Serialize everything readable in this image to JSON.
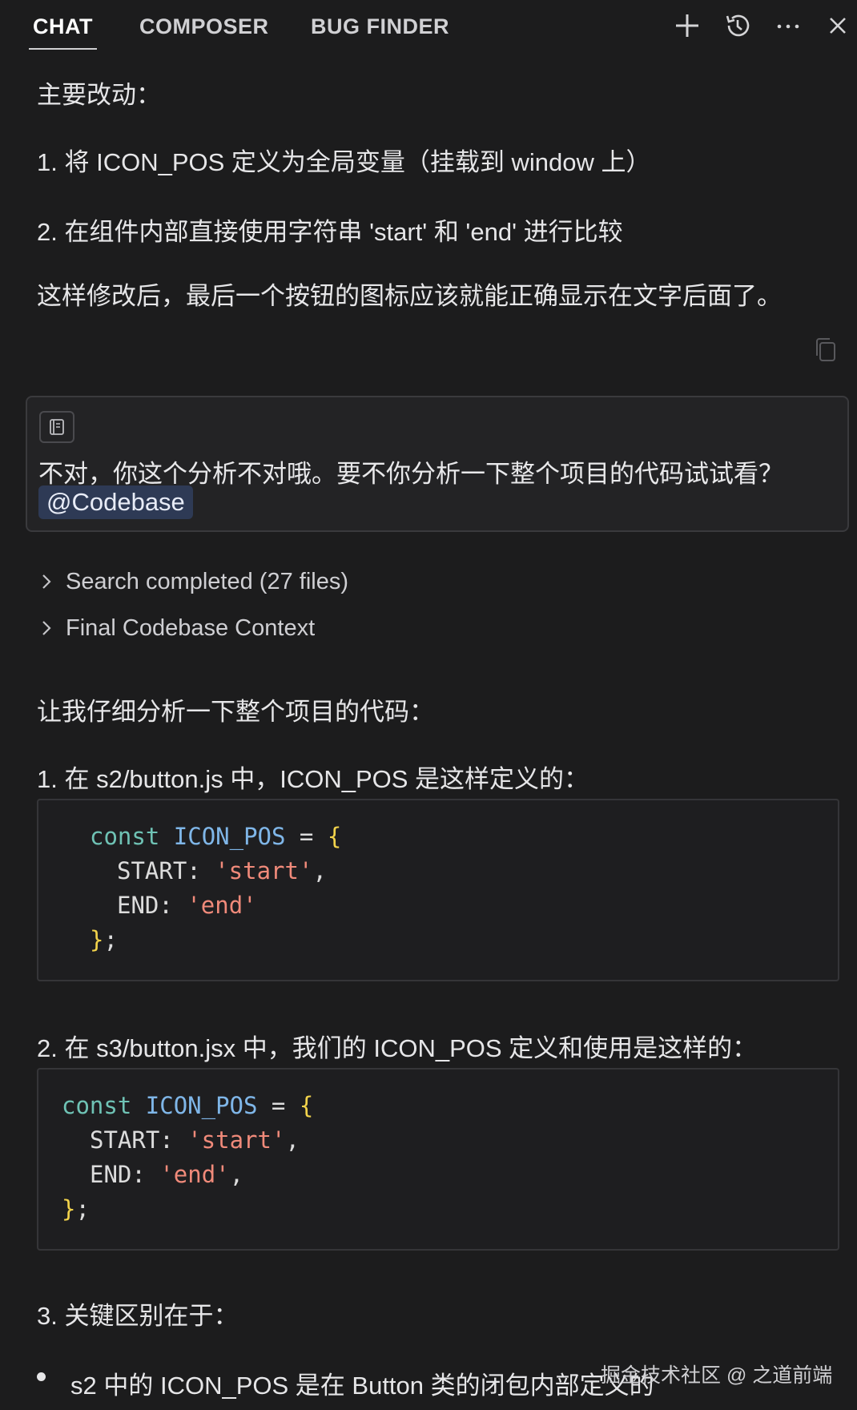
{
  "tabs": [
    {
      "label": "CHAT"
    },
    {
      "label": "COMPOSER"
    },
    {
      "label": "BUG FINDER"
    }
  ],
  "header_icons": [
    "plus-icon",
    "history-icon",
    "more-icon",
    "close-icon"
  ],
  "assistant_prev": {
    "heading": "主要改动：",
    "item1": "1. 将 ICON_POS 定义为全局变量（挂载到 window 上）",
    "item2": "2. 在组件内部直接使用字符串 'start' 和 'end' 进行比较",
    "summary": "这样修改后，最后一个按钮的图标应该就能正确显示在文字后面了。"
  },
  "user_message": {
    "text": "不对，你这个分析不对哦。要不你分析一下整个项目的代码试试看？",
    "mention": "@Codebase"
  },
  "collapsibles": [
    {
      "label": "Search completed (27 files)"
    },
    {
      "label": "Final Codebase Context"
    }
  ],
  "assistant_reply": {
    "intro": "让我仔细分析一下整个项目的代码：",
    "point1": "1. 在 s2/button.js 中，ICON_POS 是这样定义的：",
    "code1": {
      "kw": "const",
      "name": "ICON_POS",
      "eq": " = ",
      "open": "{",
      "start_key": "START: ",
      "start_val": "'start'",
      "comma": ",",
      "end_key": "END: ",
      "end_val": "'end'",
      "close": "}",
      "semi": ";"
    },
    "point2": "2. 在 s3/button.jsx 中，我们的 ICON_POS 定义和使用是这样的：",
    "code2": {
      "kw": "const",
      "name": "ICON_POS",
      "eq": " = ",
      "open": "{",
      "start_key": "START: ",
      "start_val": "'start'",
      "comma": ",",
      "end_key": "END: ",
      "end_val": "'end'",
      "end_comma": ",",
      "close": "}",
      "semi": ";"
    },
    "point3": "3. 关键区别在于：",
    "bullet1": "s2 中的 ICON_POS 是在 Button 类的闭包内部定义的"
  },
  "watermark": "掘金技术社区 @ 之道前端"
}
